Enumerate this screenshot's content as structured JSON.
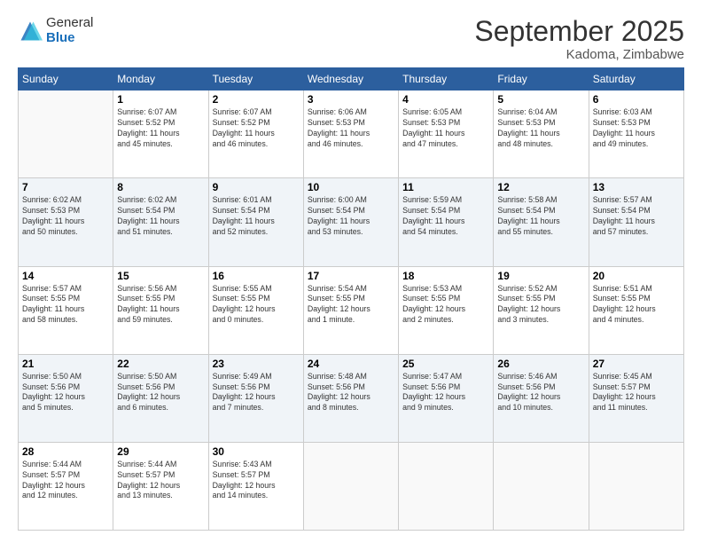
{
  "logo": {
    "general": "General",
    "blue": "Blue"
  },
  "header": {
    "month": "September 2025",
    "location": "Kadoma, Zimbabwe"
  },
  "weekdays": [
    "Sunday",
    "Monday",
    "Tuesday",
    "Wednesday",
    "Thursday",
    "Friday",
    "Saturday"
  ],
  "weeks": [
    [
      {
        "day": "",
        "info": ""
      },
      {
        "day": "1",
        "info": "Sunrise: 6:07 AM\nSunset: 5:52 PM\nDaylight: 11 hours\nand 45 minutes."
      },
      {
        "day": "2",
        "info": "Sunrise: 6:07 AM\nSunset: 5:52 PM\nDaylight: 11 hours\nand 46 minutes."
      },
      {
        "day": "3",
        "info": "Sunrise: 6:06 AM\nSunset: 5:53 PM\nDaylight: 11 hours\nand 46 minutes."
      },
      {
        "day": "4",
        "info": "Sunrise: 6:05 AM\nSunset: 5:53 PM\nDaylight: 11 hours\nand 47 minutes."
      },
      {
        "day": "5",
        "info": "Sunrise: 6:04 AM\nSunset: 5:53 PM\nDaylight: 11 hours\nand 48 minutes."
      },
      {
        "day": "6",
        "info": "Sunrise: 6:03 AM\nSunset: 5:53 PM\nDaylight: 11 hours\nand 49 minutes."
      }
    ],
    [
      {
        "day": "7",
        "info": "Sunrise: 6:02 AM\nSunset: 5:53 PM\nDaylight: 11 hours\nand 50 minutes."
      },
      {
        "day": "8",
        "info": "Sunrise: 6:02 AM\nSunset: 5:54 PM\nDaylight: 11 hours\nand 51 minutes."
      },
      {
        "day": "9",
        "info": "Sunrise: 6:01 AM\nSunset: 5:54 PM\nDaylight: 11 hours\nand 52 minutes."
      },
      {
        "day": "10",
        "info": "Sunrise: 6:00 AM\nSunset: 5:54 PM\nDaylight: 11 hours\nand 53 minutes."
      },
      {
        "day": "11",
        "info": "Sunrise: 5:59 AM\nSunset: 5:54 PM\nDaylight: 11 hours\nand 54 minutes."
      },
      {
        "day": "12",
        "info": "Sunrise: 5:58 AM\nSunset: 5:54 PM\nDaylight: 11 hours\nand 55 minutes."
      },
      {
        "day": "13",
        "info": "Sunrise: 5:57 AM\nSunset: 5:54 PM\nDaylight: 11 hours\nand 57 minutes."
      }
    ],
    [
      {
        "day": "14",
        "info": "Sunrise: 5:57 AM\nSunset: 5:55 PM\nDaylight: 11 hours\nand 58 minutes."
      },
      {
        "day": "15",
        "info": "Sunrise: 5:56 AM\nSunset: 5:55 PM\nDaylight: 11 hours\nand 59 minutes."
      },
      {
        "day": "16",
        "info": "Sunrise: 5:55 AM\nSunset: 5:55 PM\nDaylight: 12 hours\nand 0 minutes."
      },
      {
        "day": "17",
        "info": "Sunrise: 5:54 AM\nSunset: 5:55 PM\nDaylight: 12 hours\nand 1 minute."
      },
      {
        "day": "18",
        "info": "Sunrise: 5:53 AM\nSunset: 5:55 PM\nDaylight: 12 hours\nand 2 minutes."
      },
      {
        "day": "19",
        "info": "Sunrise: 5:52 AM\nSunset: 5:55 PM\nDaylight: 12 hours\nand 3 minutes."
      },
      {
        "day": "20",
        "info": "Sunrise: 5:51 AM\nSunset: 5:55 PM\nDaylight: 12 hours\nand 4 minutes."
      }
    ],
    [
      {
        "day": "21",
        "info": "Sunrise: 5:50 AM\nSunset: 5:56 PM\nDaylight: 12 hours\nand 5 minutes."
      },
      {
        "day": "22",
        "info": "Sunrise: 5:50 AM\nSunset: 5:56 PM\nDaylight: 12 hours\nand 6 minutes."
      },
      {
        "day": "23",
        "info": "Sunrise: 5:49 AM\nSunset: 5:56 PM\nDaylight: 12 hours\nand 7 minutes."
      },
      {
        "day": "24",
        "info": "Sunrise: 5:48 AM\nSunset: 5:56 PM\nDaylight: 12 hours\nand 8 minutes."
      },
      {
        "day": "25",
        "info": "Sunrise: 5:47 AM\nSunset: 5:56 PM\nDaylight: 12 hours\nand 9 minutes."
      },
      {
        "day": "26",
        "info": "Sunrise: 5:46 AM\nSunset: 5:56 PM\nDaylight: 12 hours\nand 10 minutes."
      },
      {
        "day": "27",
        "info": "Sunrise: 5:45 AM\nSunset: 5:57 PM\nDaylight: 12 hours\nand 11 minutes."
      }
    ],
    [
      {
        "day": "28",
        "info": "Sunrise: 5:44 AM\nSunset: 5:57 PM\nDaylight: 12 hours\nand 12 minutes."
      },
      {
        "day": "29",
        "info": "Sunrise: 5:44 AM\nSunset: 5:57 PM\nDaylight: 12 hours\nand 13 minutes."
      },
      {
        "day": "30",
        "info": "Sunrise: 5:43 AM\nSunset: 5:57 PM\nDaylight: 12 hours\nand 14 minutes."
      },
      {
        "day": "",
        "info": ""
      },
      {
        "day": "",
        "info": ""
      },
      {
        "day": "",
        "info": ""
      },
      {
        "day": "",
        "info": ""
      }
    ]
  ]
}
